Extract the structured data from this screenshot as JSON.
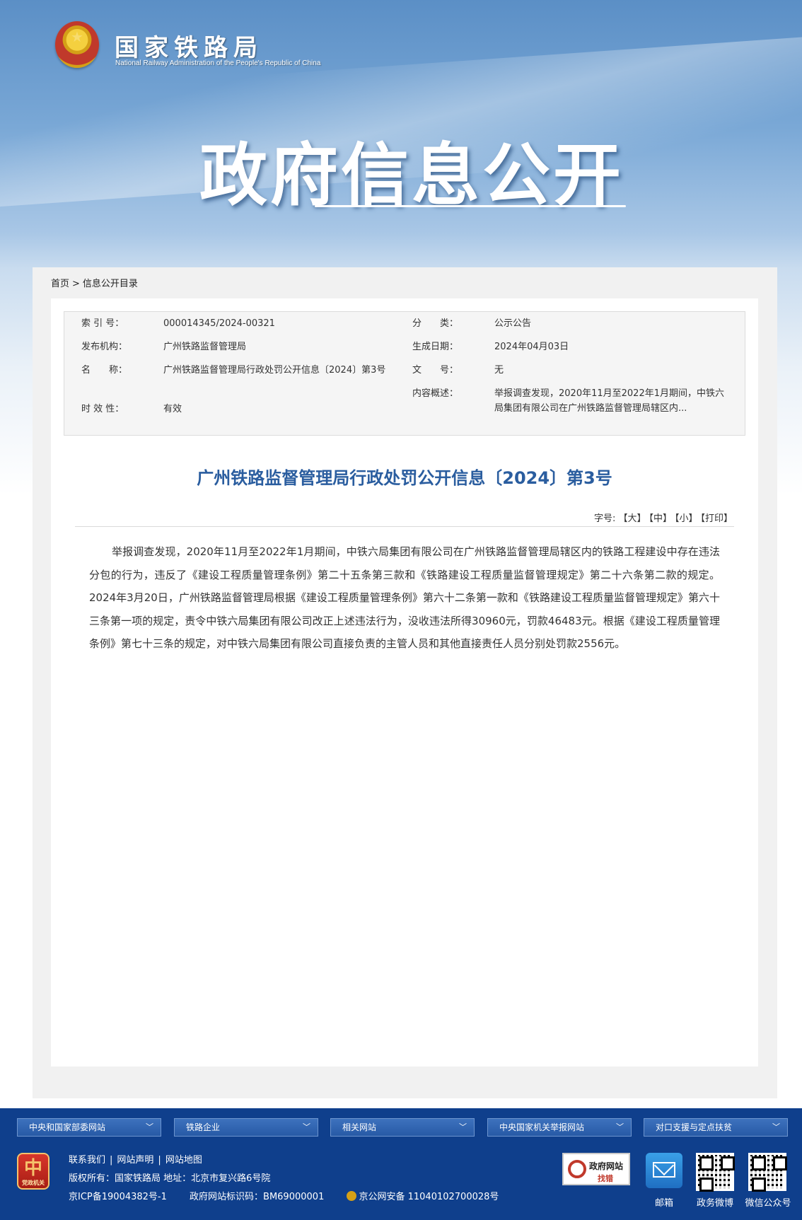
{
  "header": {
    "site_name": "国家铁路局",
    "site_name_en": "National Railway Administration of the People's Republic of China",
    "banner_title": "政府信息公开"
  },
  "breadcrumb": {
    "home": "首页",
    "separator": ">",
    "current": "信息公开目录"
  },
  "meta": {
    "index_label": "索 引 号：",
    "index_value": "000014345/2024-00321",
    "category_label": "分　　类：",
    "category_value": "公示公告",
    "publisher_label": "发布机构：",
    "publisher_value": "广州铁路监督管理局",
    "date_label": "生成日期：",
    "date_value": "2024年04月03日",
    "name_label": "名　　称：",
    "name_value": "广州铁路监督管理局行政处罚公开信息〔2024〕第3号",
    "docno_label": "文　　号：",
    "docno_value": "无",
    "summary_label": "内容概述：",
    "summary_value": "举报调查发现，2020年11月至2022年1月期间，中铁六局集团有限公司在广州铁路监督管理局辖区内...",
    "validity_label": "时 效 性：",
    "validity_value": "有效"
  },
  "article": {
    "title": "广州铁路监督管理局行政处罚公开信息〔2024〕第3号",
    "font_size_label": "字号:",
    "font_large": "【大】",
    "font_medium": "【中】",
    "font_small": "【小】",
    "print": "【打印】",
    "body": "举报调查发现，2020年11月至2022年1月期间，中铁六局集团有限公司在广州铁路监督管理局辖区内的铁路工程建设中存在违法分包的行为，违反了《建设工程质量管理条例》第二十五条第三款和《铁路建设工程质量监督管理规定》第二十六条第二款的规定。2024年3月20日，广州铁路监督管理局根据《建设工程质量管理条例》第六十二条第一款和《铁路建设工程质量监督管理规定》第六十三条第一项的规定，责令中铁六局集团有限公司改正上述违法行为，没收违法所得30960元，罚款46483元。根据《建设工程质量管理条例》第七十三条的规定，对中铁六局集团有限公司直接负责的主管人员和其他直接责任人员分别处罚款2556元。"
  },
  "footer": {
    "selects": [
      "中央和国家部委网站",
      "铁路企业",
      "相关网站",
      "中央国家机关举报网站",
      "对口支援与定点扶贫"
    ],
    "badge_text": "党政机关",
    "nav": [
      "联系我们",
      "网站声明",
      "网站地图"
    ],
    "nav_sep": "|",
    "copyright": "版权所有：国家铁路局  地址：北京市复兴路6号院",
    "icp": "京ICP备19004382号-1",
    "gov_id": "政府网站标识码：BM69000001",
    "police": "京公网安备 11040102700028号",
    "gov_badge_t1": "政府网站",
    "gov_badge_t2": "找错",
    "mail": "邮箱",
    "weibo": "政务微博",
    "wechat": "微信公众号"
  }
}
